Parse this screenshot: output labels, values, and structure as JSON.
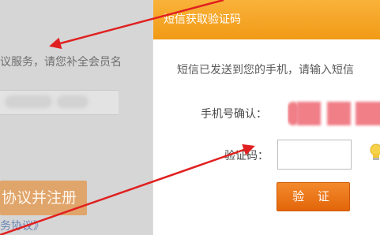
{
  "left_page": {
    "notice_text": "议服务，请您补全会员名",
    "agree_button": "协议并注册",
    "agreement_link": "务协议》"
  },
  "dialog": {
    "title": "短信获取验证码",
    "hint": "短信已发送到您的手机，请输入短信",
    "phone_label": "手机号确认：",
    "code_label": "验证码：",
    "code_value": "",
    "verify_button": "验 证"
  },
  "colors": {
    "header": "#f39f1c",
    "button": "#ec7419",
    "arrow": "#e02020",
    "mask": "#f07f88"
  },
  "icons": [
    "lightbulb-icon",
    "arrow-annotation"
  ]
}
